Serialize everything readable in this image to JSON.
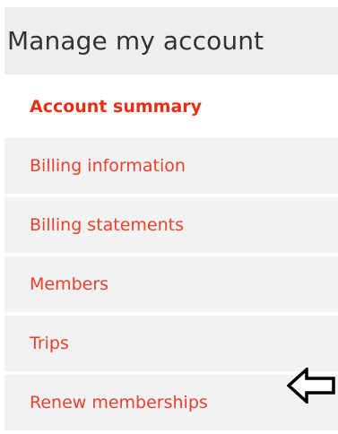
{
  "panel": {
    "title": "Manage my account",
    "items": [
      {
        "label": "Account summary",
        "active": true
      },
      {
        "label": "Billing information",
        "active": false
      },
      {
        "label": "Billing statements",
        "active": false
      },
      {
        "label": "Members",
        "active": false
      },
      {
        "label": "Trips",
        "active": false
      },
      {
        "label": "Renew memberships",
        "active": false
      }
    ]
  },
  "annotation": {
    "icon": "left-arrow-icon",
    "stroke": "#000000",
    "fill": "#ffffff"
  },
  "colors": {
    "accent": "#e8412e",
    "header_bg": "#eeeeee",
    "item_bg": "#f2f2f2"
  }
}
